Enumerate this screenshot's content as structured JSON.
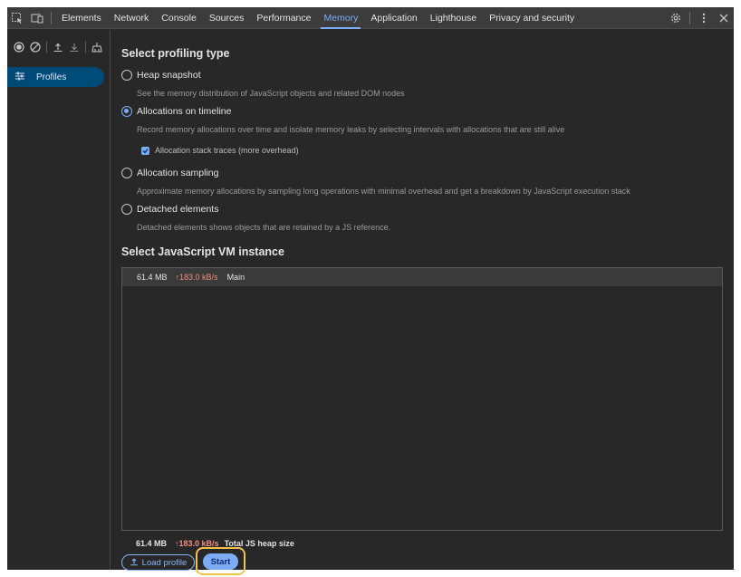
{
  "tabs": [
    {
      "label": "Elements"
    },
    {
      "label": "Network"
    },
    {
      "label": "Console"
    },
    {
      "label": "Sources"
    },
    {
      "label": "Performance"
    },
    {
      "label": "Memory",
      "active": true
    },
    {
      "label": "Application"
    },
    {
      "label": "Lighthouse"
    },
    {
      "label": "Privacy and security"
    }
  ],
  "sidebar": {
    "profiles_label": "Profiles"
  },
  "main": {
    "profiling_heading": "Select profiling type",
    "options": [
      {
        "label": "Heap snapshot",
        "desc": "See the memory distribution of JavaScript objects and related DOM nodes",
        "selected": false
      },
      {
        "label": "Allocations on timeline",
        "desc": "Record memory allocations over time and isolate memory leaks by selecting intervals with allocations that are still alive",
        "selected": true
      },
      {
        "label": "Allocation sampling",
        "desc": "Approximate memory allocations by sampling long operations with minimal overhead and get a breakdown by JavaScript execution stack",
        "selected": false
      },
      {
        "label": "Detached elements",
        "desc": "Detached elements shows objects that are retained by a JS reference.",
        "selected": false
      }
    ],
    "checkbox_label": "Allocation stack traces (more overhead)",
    "vm_heading": "Select JavaScript VM instance",
    "vm_row": {
      "size": "61.4 MB",
      "rate": "↑183.0 kB/s",
      "name": "Main"
    },
    "footer": {
      "size": "61.4 MB",
      "rate": "↑183.0 kB/s",
      "label": "Total JS heap size"
    },
    "load_button": "Load profile",
    "start_button": "Start"
  },
  "colors": {
    "accent": "#7cacf8",
    "rate": "#f28b82",
    "highlight": "#f3c34a"
  },
  "icons": [
    "inspect-element-icon",
    "device-toolbar-icon",
    "settings-gear-icon",
    "kebab-menu-icon",
    "close-icon",
    "record-icon",
    "clear-icon",
    "upload-icon",
    "download-icon",
    "garbage-collect-icon",
    "profiles-icon"
  ]
}
